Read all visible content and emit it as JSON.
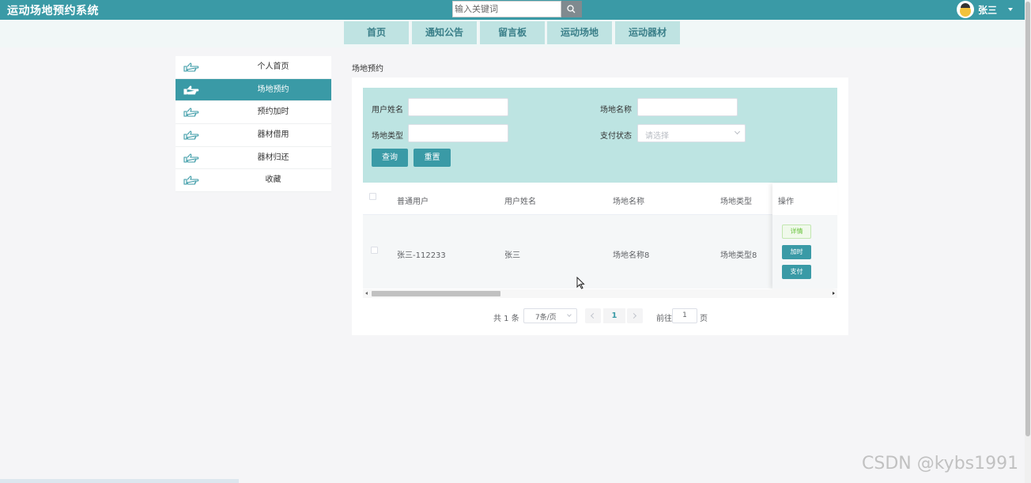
{
  "app": {
    "title": "运动场地预约系统"
  },
  "search": {
    "placeholder": "输入关键词",
    "icon": "search-icon"
  },
  "user": {
    "name": "张三"
  },
  "nav": {
    "tabs": [
      {
        "label": "首页"
      },
      {
        "label": "通知公告"
      },
      {
        "label": "留言板"
      },
      {
        "label": "运动场地"
      },
      {
        "label": "运动器材"
      }
    ]
  },
  "sidebar": {
    "items": [
      {
        "label": "个人首页",
        "active": false
      },
      {
        "label": "场地预约",
        "active": true
      },
      {
        "label": "预约加时",
        "active": false
      },
      {
        "label": "器材借用",
        "active": false
      },
      {
        "label": "器材归还",
        "active": false
      },
      {
        "label": "收藏",
        "active": false
      }
    ]
  },
  "breadcrumb": "场地预约",
  "filter": {
    "user_name_label": "用户姓名",
    "venue_name_label": "场地名称",
    "venue_type_label": "场地类型",
    "pay_status_label": "支付状态",
    "pay_status_placeholder": "请选择",
    "query_label": "查询",
    "reset_label": "重置"
  },
  "table": {
    "columns": [
      "普通用户",
      "用户姓名",
      "场地名称",
      "场地类型"
    ],
    "op_header": "操作",
    "rows": [
      {
        "cells": [
          "张三-112233",
          "张三",
          "场地名称8",
          "场地类型8"
        ]
      }
    ],
    "actions": {
      "detail": "详情",
      "extend": "加时",
      "pay": "支付"
    }
  },
  "pagination": {
    "total": "共 1 条",
    "page_size": "7条/页",
    "current_page": "1",
    "goto_label": "前往",
    "goto_value": "1",
    "page_unit": "页"
  },
  "watermark": "CSDN @kybs1991",
  "colors": {
    "primary": "#3a9aa6",
    "filter_bg": "#bde4e2",
    "nav_tab": "#bfe3e2"
  }
}
